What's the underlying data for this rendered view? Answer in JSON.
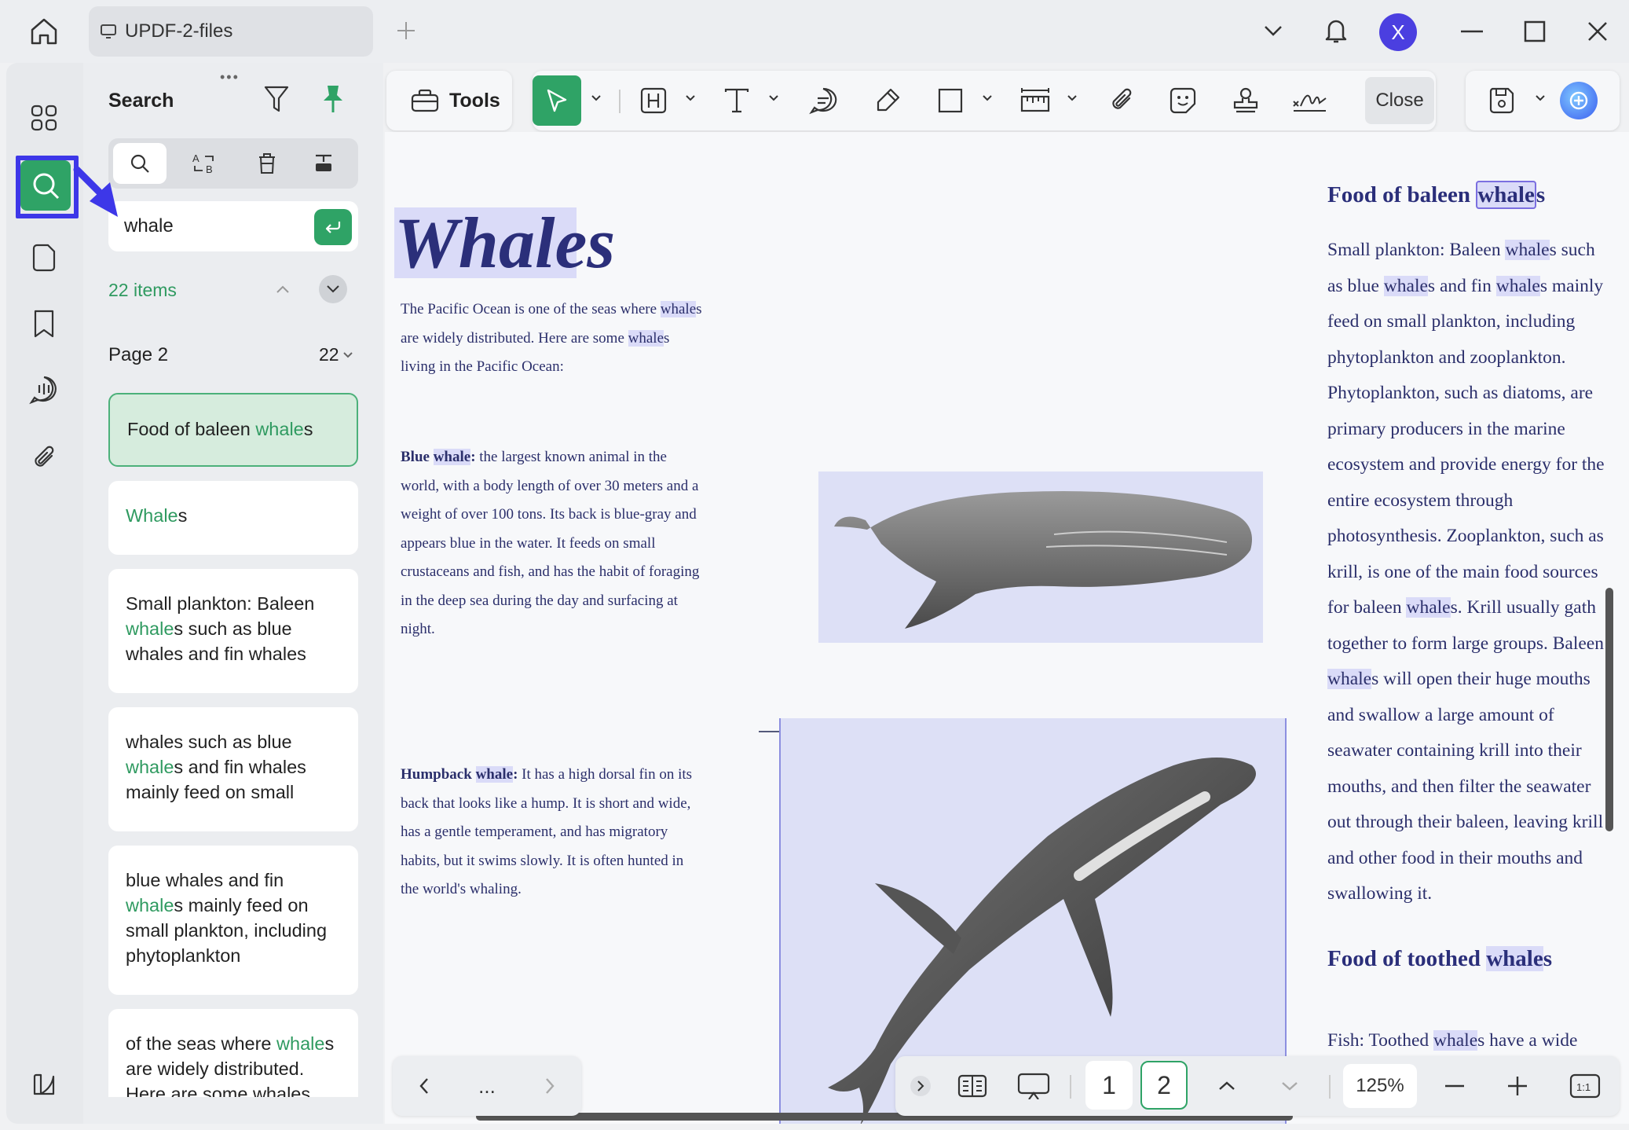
{
  "titlebar": {
    "tab_title": "UPDF-2-files",
    "avatar_letter": "X"
  },
  "search_panel": {
    "title": "Search",
    "query": "whale",
    "items_count": "22 items",
    "page_label": "Page 2",
    "page_count": "22",
    "results": [
      {
        "before": "Food of baleen ",
        "match": "whale",
        "after": "s"
      },
      {
        "before": "",
        "match": "Whale",
        "after": "s"
      },
      {
        "before": "Small plankton: Baleen ",
        "match": "whale",
        "after": "s such as blue whales and fin whales"
      },
      {
        "before": "whales such as blue ",
        "match": "whale",
        "after": "s and fin whales mainly feed on small"
      },
      {
        "before": "blue whales and fin ",
        "match": "whale",
        "after": "s mainly feed on small plankton, including phytoplankton"
      },
      {
        "before": "of the seas where ",
        "match": "whale",
        "after": "s are widely distributed. Here are some whales"
      }
    ]
  },
  "toolbar": {
    "tools_label": "Tools",
    "close_label": "Close"
  },
  "document": {
    "title": "Whales",
    "intro": {
      "a": "The Pacific Ocean is one of the seas where ",
      "b": "whale",
      "c": "s",
      "d": "are widely distributed. Here are some ",
      "e": "whale",
      "f": "s",
      "g": "living in the Pacific Ocean:"
    },
    "blue": {
      "label": "Blue ",
      "label_hl": "whale",
      "colon": ":",
      "l1": " the largest known animal in the",
      "l2": "world, with a body length of over 30 meters and a",
      "l3": "weight of over 100 tons. Its back is blue-gray and",
      "l4": "appears blue in the water. It feeds on small",
      "l5": "crustaceans and fish, and has the habit of foraging",
      "l6": "in the deep sea during the day and surfacing at",
      "l7": "night."
    },
    "humpback": {
      "label": "Humpback ",
      "label_hl": "whale",
      "colon": ":",
      "l1": " It has a high dorsal fin on its",
      "l2": "back that looks like a hump. It is short and wide,",
      "l3": "has a gentle temperament, and has migratory",
      "l4": "habits, but it swims slowly. It is often hunted in",
      "l5": "the world's whaling."
    },
    "right": {
      "h1a": "Food of baleen ",
      "h1b": "whale",
      "h1c": "s",
      "lines": [
        [
          "Small plankton: Baleen ",
          "whale",
          "s such"
        ],
        [
          "as blue ",
          "whale",
          "s and fin ",
          "whale",
          "s mainly"
        ],
        [
          "feed on small plankton, including"
        ],
        [
          "phytoplankton and zooplankton."
        ],
        [
          "Phytoplankton, such as diatoms, are"
        ],
        [
          "primary producers in the marine"
        ],
        [
          "ecosystem and provide energy for the"
        ],
        [
          "entire ecosystem through"
        ],
        [
          "photosynthesis. Zooplankton, such as"
        ],
        [
          "krill, is one of the main food sources"
        ],
        [
          "for baleen ",
          "whale",
          "s. Krill usually gath"
        ],
        [
          "together to form large groups. Baleen"
        ],
        [
          "",
          "whale",
          "s will open their huge mouths"
        ],
        [
          "and swallow a large amount of"
        ],
        [
          "seawater containing krill into their"
        ],
        [
          "mouths, and then filter the seawater"
        ],
        [
          "out through their baleen, leaving krill"
        ],
        [
          "and other food in their mouths and"
        ],
        [
          "swallowing it."
        ]
      ],
      "h2a": "Food of toothed ",
      "h2b": "whale",
      "h2c": "s",
      "last_a": "Fish: Toothed ",
      "last_b": "whale",
      "last_c": "s have a wide"
    }
  },
  "bottom_bar": {
    "page_1": "1",
    "page_2": "2",
    "zoom": "125%",
    "nav_more": "..."
  }
}
